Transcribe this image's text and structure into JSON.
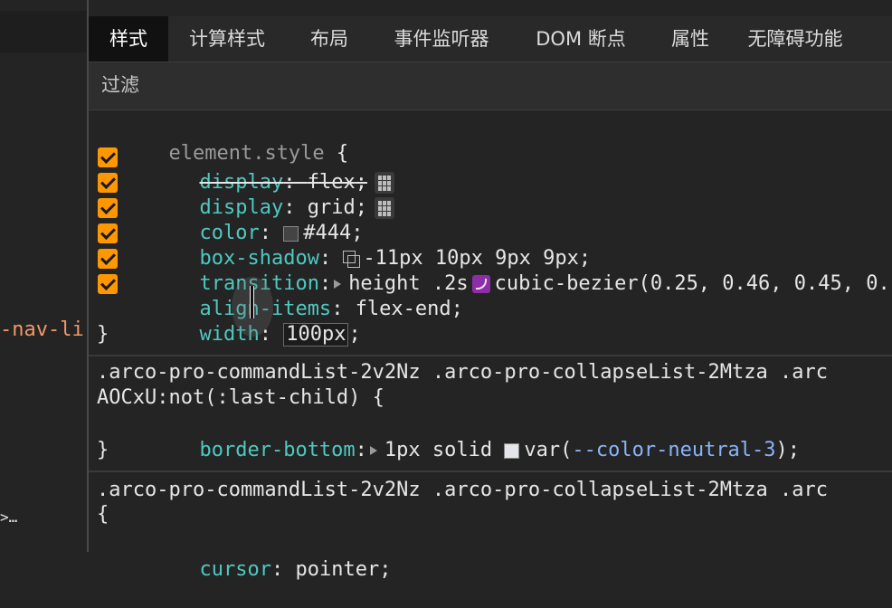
{
  "left_panel": {
    "partial_class": "-nav-li",
    "ellipsis_arrow": ">",
    "ellipsis": "…"
  },
  "tabs": [
    {
      "label": "样式",
      "active": true
    },
    {
      "label": "计算样式",
      "active": false
    },
    {
      "label": "布局",
      "active": false
    },
    {
      "label": "事件监听器",
      "active": false
    },
    {
      "label": "DOM 断点",
      "active": false
    },
    {
      "label": "属性",
      "active": false
    },
    {
      "label": "无障碍功能",
      "active": false
    }
  ],
  "filter": {
    "placeholder": "过滤"
  },
  "rule1": {
    "selector": "element.style",
    "open": " {",
    "close": "}",
    "props": [
      {
        "name": "display",
        "value": "flex",
        "checked": true,
        "overridden": true,
        "icon": "grid-editor-icon"
      },
      {
        "name": "display",
        "value": "grid",
        "checked": true,
        "overridden": false,
        "icon": "grid-editor-icon"
      },
      {
        "name": "color",
        "value": "#444",
        "swatch": "#444444",
        "checked": true
      },
      {
        "name": "box-shadow",
        "value": "-11px 10px 9px 9px",
        "checked": true,
        "icon": "shadow-editor-icon"
      },
      {
        "name": "transition",
        "value_pre": "height .2s",
        "value_post": "cubic-bezier(0.25, 0.46, 0.45, 0.",
        "checked": true,
        "icon": "bezier-editor-icon"
      },
      {
        "name": "align-items",
        "value": "flex-end",
        "checked": true
      },
      {
        "name": "width",
        "value": "100px",
        "editing": true
      }
    ]
  },
  "rule2": {
    "selector_line1": ".arco-pro-commandList-2v2Nz .arco-pro-collapseList-2Mtza .arc",
    "selector_line2": "AOCxU:not(:last-child)",
    "open": " {",
    "prop_name": "border-bottom",
    "value_pre": "1px solid",
    "swatch": "#e5e6eb",
    "var_func": "var(",
    "var_name": "--color-neutral-3",
    "var_close": ");",
    "close": "}"
  },
  "rule3": {
    "selector_line1": ".arco-pro-commandList-2v2Nz .arco-pro-collapseList-2Mtza .arc",
    "open": "{",
    "prop_name": "cursor",
    "value": "pointer"
  },
  "colors": {
    "accent_checkbox": "#ff9800",
    "property": "#4ec9c0",
    "var": "#8ab4f8",
    "bezier": "#8c2ea6",
    "active_tab": "#111111"
  }
}
